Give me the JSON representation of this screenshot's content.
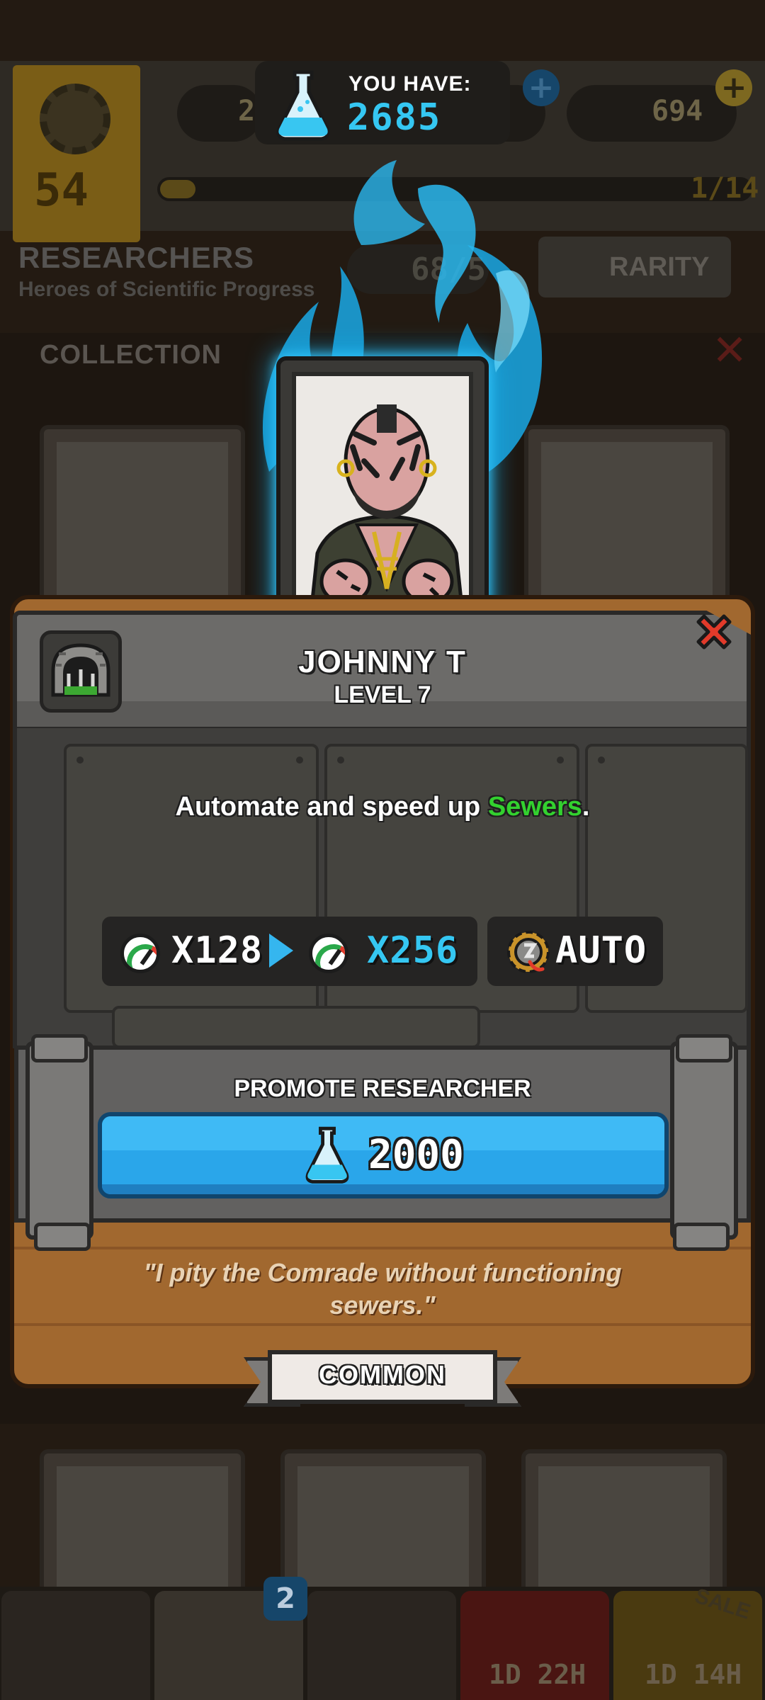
{
  "background": {
    "level": "54",
    "currency_partial_1": "2",
    "currency_partial_2": "685",
    "gold": "694",
    "progress_text": "1/14",
    "progress_fraction": 0.07,
    "section_title": "RESEARCHERS",
    "section_subtitle": "Heroes of Scientific Progress",
    "count_partial": "68/5",
    "filter_label": "RARITY",
    "collection_label": "COLLECTION",
    "cards_badge": "2",
    "timer_1": "1D 22H",
    "timer_2": "1D 14H",
    "sale_label": "SALE"
  },
  "currency": {
    "label": "YOU HAVE:",
    "value": "2685",
    "icon": "flask-icon"
  },
  "researcher": {
    "name": "JOHNNY T",
    "level": "LEVEL 7",
    "description_prefix": "Automate and speed up ",
    "description_highlight": "Sewers",
    "description_suffix": ".",
    "building_icon": "sewer-icon",
    "speed_from": "X128",
    "speed_to": "X256",
    "ability": "AUTO",
    "quote_line1": "\"I pity the Comrade without functioning",
    "quote_line2": "sewers.\"",
    "rarity": "COMMON"
  },
  "promote": {
    "label": "PROMOTE RESEARCHER",
    "cost": "2000"
  },
  "colors": {
    "accent_blue": "#35c7f2",
    "highlight_green": "#33d12f",
    "button_blue": "#2aa6ea",
    "close_red": "#e23a2a"
  }
}
